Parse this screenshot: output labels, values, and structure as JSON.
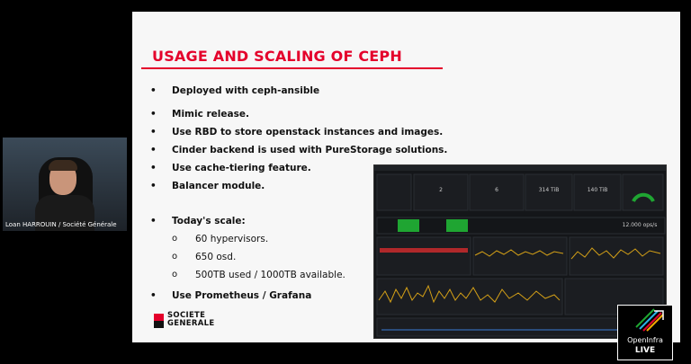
{
  "slide": {
    "title": "USAGE AND SCALING OF CEPH",
    "bullets": [
      {
        "text": "Deployed with ceph-ansible"
      },
      {
        "text": "Mimic release."
      },
      {
        "text": "Use RBD to store openstack instances and images."
      },
      {
        "text": "Cinder backend is used with PureStorage solutions."
      },
      {
        "text": "Use cache-tiering feature."
      },
      {
        "text": "Balancer module."
      },
      {
        "text": "Today's scale:"
      },
      {
        "text": "Use Prometheus / Grafana"
      }
    ],
    "sub_bullets": [
      "60 hypervisors.",
      "650 osd.",
      "500TB used / 1000TB available."
    ],
    "bullet_glyph": "•",
    "sub_glyph": "o",
    "logo_line1": "SOCIETE",
    "logo_line2": "GENERALE"
  },
  "dashboard": {
    "stats": [
      "2",
      "6",
      "314 TiB",
      "140 TiB"
    ],
    "summary": "12.000 ops/s",
    "status_color": "#1fa532"
  },
  "video": {
    "caption": "Loan HARROUIN / Société Générale"
  },
  "badge": {
    "line1": "OpenInfra",
    "line2": "LIVE"
  }
}
